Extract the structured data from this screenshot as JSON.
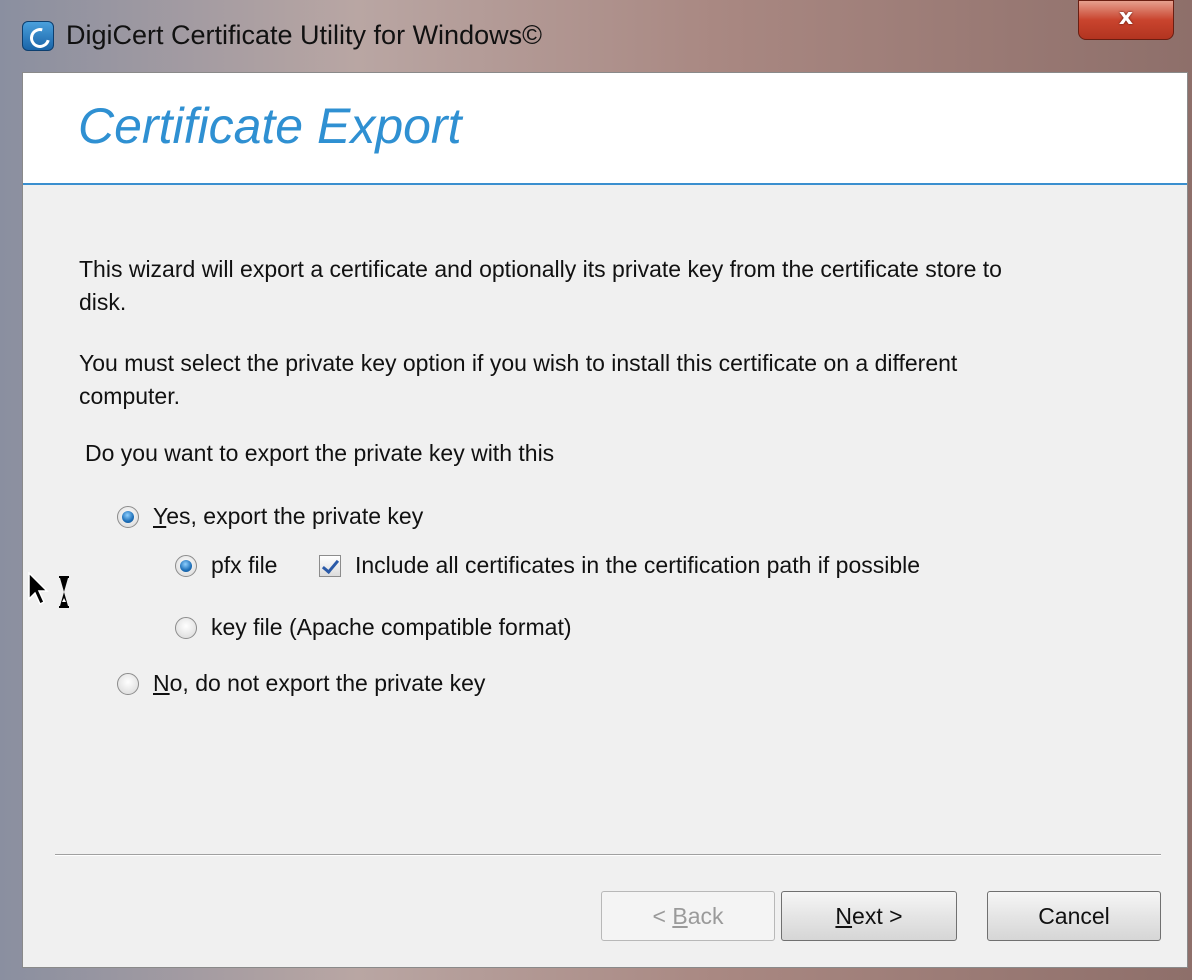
{
  "window": {
    "title": "DigiCert Certificate Utility for Windows©",
    "close_glyph": "x"
  },
  "header": {
    "title": "Certificate Export"
  },
  "body": {
    "intro": "This wizard will export a certificate and optionally its private key from the certificate store to disk.",
    "note": "You must select the private key option if you wish to install this certificate on a different computer.",
    "question": "Do you want to export the private key with this"
  },
  "options": {
    "yes_export": {
      "mnemonic": "Y",
      "rest": "es, export the private key",
      "selected": true
    },
    "pfx_file": {
      "label": "pfx file",
      "selected": true
    },
    "include_all": {
      "label": "Include all certificates in the certification path if possible",
      "checked": true
    },
    "key_file": {
      "label": "key file (Apache compatible format)",
      "selected": false
    },
    "no_export": {
      "mnemonic": "N",
      "rest": "o, do not export the private key",
      "selected": false
    }
  },
  "buttons": {
    "back": {
      "prefix": "< ",
      "mnemonic": "B",
      "rest": "ack",
      "enabled": false
    },
    "next": {
      "mnemonic": "N",
      "rest": "ext >"
    },
    "cancel": {
      "label": "Cancel"
    }
  },
  "colors": {
    "accent": "#2f90d2",
    "header_rule": "#3a8fcf",
    "close_button": "#c9442e"
  },
  "icons": {
    "app": "digicert-icon",
    "cursor": "busy-cursor-icon"
  }
}
